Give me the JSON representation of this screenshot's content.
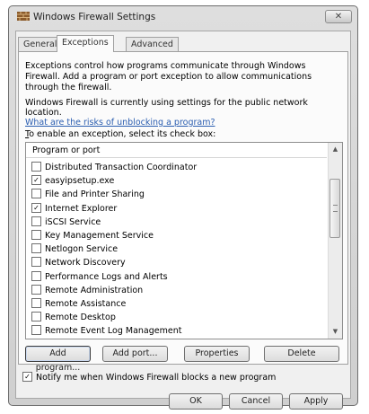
{
  "window": {
    "title": "Windows Firewall Settings",
    "close_glyph": "✕"
  },
  "tabs": [
    {
      "label": "General"
    },
    {
      "label": "Exceptions"
    },
    {
      "label": "Advanced"
    }
  ],
  "exceptions": {
    "description": "Exceptions control how programs communicate through Windows Firewall. Add a program or port exception to allow communications through the firewall.",
    "status": "Windows Firewall is currently using settings for the public network location.",
    "risk_link": "What are the risks of unblocking a program?",
    "enable_label_key": "T",
    "enable_label_rest": "o enable an exception, select its check box:",
    "list_header": "Program or port",
    "items": [
      {
        "label": "Distributed Transaction Coordinator",
        "checked": false
      },
      {
        "label": "easyipsetup.exe",
        "checked": true
      },
      {
        "label": "File and Printer Sharing",
        "checked": false
      },
      {
        "label": "Internet Explorer",
        "checked": true
      },
      {
        "label": "iSCSI Service",
        "checked": false
      },
      {
        "label": "Key Management Service",
        "checked": false
      },
      {
        "label": "Netlogon Service",
        "checked": false
      },
      {
        "label": "Network Discovery",
        "checked": false
      },
      {
        "label": "Performance Logs and Alerts",
        "checked": false
      },
      {
        "label": "Remote Administration",
        "checked": false
      },
      {
        "label": "Remote Assistance",
        "checked": false
      },
      {
        "label": "Remote Desktop",
        "checked": false
      },
      {
        "label": "Remote Event Log Management",
        "checked": false
      }
    ],
    "buttons": {
      "add_program": "Add program...",
      "add_port": "Add port...",
      "properties": "Properties",
      "delete": "Delete"
    },
    "notify": {
      "label": "Notify me when Windows Firewall blocks a new program",
      "checked": true
    }
  },
  "dialog_buttons": {
    "ok": "OK",
    "cancel": "Cancel",
    "apply": "Apply"
  }
}
